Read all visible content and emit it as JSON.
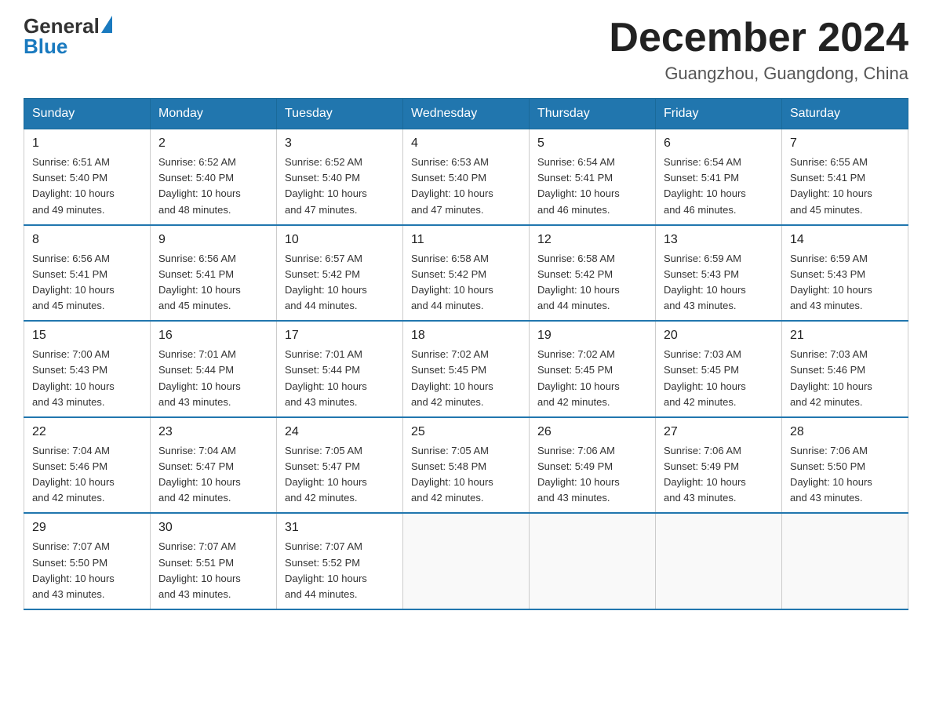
{
  "header": {
    "logo_general": "General",
    "logo_blue": "Blue",
    "month_title": "December 2024",
    "location": "Guangzhou, Guangdong, China"
  },
  "days_of_week": [
    "Sunday",
    "Monday",
    "Tuesday",
    "Wednesday",
    "Thursday",
    "Friday",
    "Saturday"
  ],
  "weeks": [
    [
      {
        "day": "1",
        "sunrise": "6:51 AM",
        "sunset": "5:40 PM",
        "daylight": "10 hours and 49 minutes."
      },
      {
        "day": "2",
        "sunrise": "6:52 AM",
        "sunset": "5:40 PM",
        "daylight": "10 hours and 48 minutes."
      },
      {
        "day": "3",
        "sunrise": "6:52 AM",
        "sunset": "5:40 PM",
        "daylight": "10 hours and 47 minutes."
      },
      {
        "day": "4",
        "sunrise": "6:53 AM",
        "sunset": "5:40 PM",
        "daylight": "10 hours and 47 minutes."
      },
      {
        "day": "5",
        "sunrise": "6:54 AM",
        "sunset": "5:41 PM",
        "daylight": "10 hours and 46 minutes."
      },
      {
        "day": "6",
        "sunrise": "6:54 AM",
        "sunset": "5:41 PM",
        "daylight": "10 hours and 46 minutes."
      },
      {
        "day": "7",
        "sunrise": "6:55 AM",
        "sunset": "5:41 PM",
        "daylight": "10 hours and 45 minutes."
      }
    ],
    [
      {
        "day": "8",
        "sunrise": "6:56 AM",
        "sunset": "5:41 PM",
        "daylight": "10 hours and 45 minutes."
      },
      {
        "day": "9",
        "sunrise": "6:56 AM",
        "sunset": "5:41 PM",
        "daylight": "10 hours and 45 minutes."
      },
      {
        "day": "10",
        "sunrise": "6:57 AM",
        "sunset": "5:42 PM",
        "daylight": "10 hours and 44 minutes."
      },
      {
        "day": "11",
        "sunrise": "6:58 AM",
        "sunset": "5:42 PM",
        "daylight": "10 hours and 44 minutes."
      },
      {
        "day": "12",
        "sunrise": "6:58 AM",
        "sunset": "5:42 PM",
        "daylight": "10 hours and 44 minutes."
      },
      {
        "day": "13",
        "sunrise": "6:59 AM",
        "sunset": "5:43 PM",
        "daylight": "10 hours and 43 minutes."
      },
      {
        "day": "14",
        "sunrise": "6:59 AM",
        "sunset": "5:43 PM",
        "daylight": "10 hours and 43 minutes."
      }
    ],
    [
      {
        "day": "15",
        "sunrise": "7:00 AM",
        "sunset": "5:43 PM",
        "daylight": "10 hours and 43 minutes."
      },
      {
        "day": "16",
        "sunrise": "7:01 AM",
        "sunset": "5:44 PM",
        "daylight": "10 hours and 43 minutes."
      },
      {
        "day": "17",
        "sunrise": "7:01 AM",
        "sunset": "5:44 PM",
        "daylight": "10 hours and 43 minutes."
      },
      {
        "day": "18",
        "sunrise": "7:02 AM",
        "sunset": "5:45 PM",
        "daylight": "10 hours and 42 minutes."
      },
      {
        "day": "19",
        "sunrise": "7:02 AM",
        "sunset": "5:45 PM",
        "daylight": "10 hours and 42 minutes."
      },
      {
        "day": "20",
        "sunrise": "7:03 AM",
        "sunset": "5:45 PM",
        "daylight": "10 hours and 42 minutes."
      },
      {
        "day": "21",
        "sunrise": "7:03 AM",
        "sunset": "5:46 PM",
        "daylight": "10 hours and 42 minutes."
      }
    ],
    [
      {
        "day": "22",
        "sunrise": "7:04 AM",
        "sunset": "5:46 PM",
        "daylight": "10 hours and 42 minutes."
      },
      {
        "day": "23",
        "sunrise": "7:04 AM",
        "sunset": "5:47 PM",
        "daylight": "10 hours and 42 minutes."
      },
      {
        "day": "24",
        "sunrise": "7:05 AM",
        "sunset": "5:47 PM",
        "daylight": "10 hours and 42 minutes."
      },
      {
        "day": "25",
        "sunrise": "7:05 AM",
        "sunset": "5:48 PM",
        "daylight": "10 hours and 42 minutes."
      },
      {
        "day": "26",
        "sunrise": "7:06 AM",
        "sunset": "5:49 PM",
        "daylight": "10 hours and 43 minutes."
      },
      {
        "day": "27",
        "sunrise": "7:06 AM",
        "sunset": "5:49 PM",
        "daylight": "10 hours and 43 minutes."
      },
      {
        "day": "28",
        "sunrise": "7:06 AM",
        "sunset": "5:50 PM",
        "daylight": "10 hours and 43 minutes."
      }
    ],
    [
      {
        "day": "29",
        "sunrise": "7:07 AM",
        "sunset": "5:50 PM",
        "daylight": "10 hours and 43 minutes."
      },
      {
        "day": "30",
        "sunrise": "7:07 AM",
        "sunset": "5:51 PM",
        "daylight": "10 hours and 43 minutes."
      },
      {
        "day": "31",
        "sunrise": "7:07 AM",
        "sunset": "5:52 PM",
        "daylight": "10 hours and 44 minutes."
      },
      null,
      null,
      null,
      null
    ]
  ],
  "labels": {
    "sunrise": "Sunrise:",
    "sunset": "Sunset:",
    "daylight": "Daylight:"
  }
}
